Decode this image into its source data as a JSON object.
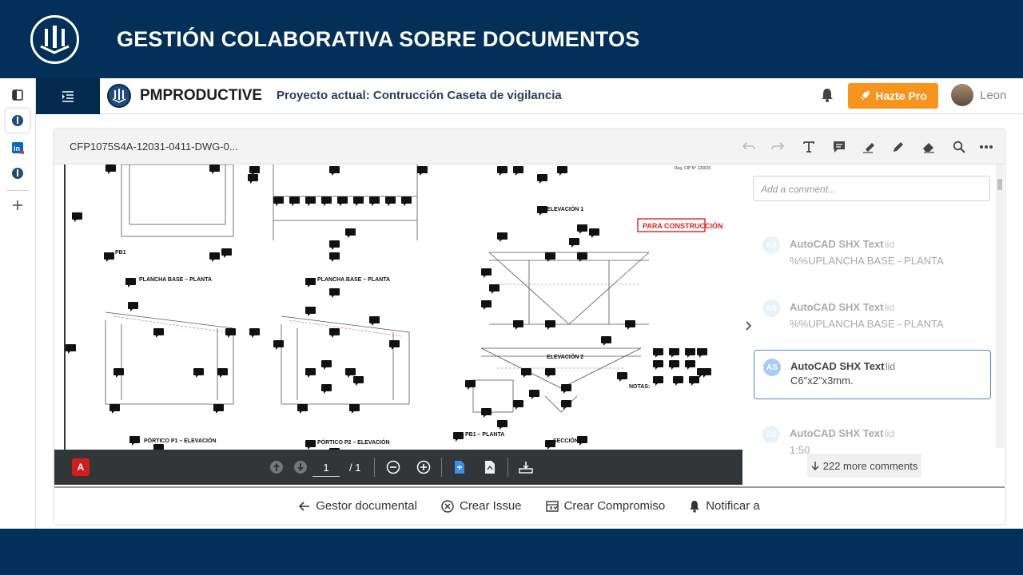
{
  "slide": {
    "title": "GESTIÓN COLABORATIVA SOBRE DOCUMENTOS",
    "colors": {
      "banner": "#023058",
      "accent": "#f7941d",
      "active_comment": "#4d8ad6"
    }
  },
  "rail": {
    "items": [
      {
        "icon": "panel-toggle-icon"
      },
      {
        "icon": "pmproductive-app-icon"
      },
      {
        "icon": "linkedin-icon"
      },
      {
        "icon": "pmproductive-app-icon"
      },
      {
        "icon": "plus-icon"
      }
    ]
  },
  "header": {
    "app_name": "PMPRODUCTIVE",
    "project": "Proyecto actual: Contrucción Caseta de vigilancia",
    "pro_button": "Hazte Pro",
    "user": "Leon"
  },
  "viewer": {
    "document_name": "CFP1075S4A-12031-0411-DWG-0...",
    "toolbar_icons": [
      "undo-icon",
      "redo-icon",
      "text-icon",
      "comment-icon",
      "highlight-icon",
      "pen-icon",
      "eraser-icon",
      "search-icon",
      "more-icon"
    ],
    "pdf": {
      "page": "1",
      "total": "/ 1",
      "logo": "A"
    }
  },
  "drawing": {
    "cip": "Reg. CIP N° 120620",
    "stamp": "PARA CONSTRUCCIÓN",
    "labels": {
      "l1": "PB1",
      "l2": "PLANCHA BASE – PLANTA",
      "l3": "PLANCHA BASE – PLANTA",
      "l4": "ELEVACIÓN 1",
      "l5": "ELEVACIÓN 2",
      "l6": "PÓRTICO P1 – ELEVACIÓN",
      "l7": "PÓRTICO P2 – ELEVACIÓN",
      "l8": "PB1 – PLANTA",
      "l9": "SECCIÓN",
      "l10": "NOTAS:"
    }
  },
  "comments": {
    "placeholder": "Add a comment...",
    "items": [
      {
        "avatar": "AS",
        "author": "AutoCAD SHX Text",
        "date": "lid",
        "text": "%%UPLANCHA BASE - PLANTA"
      },
      {
        "avatar": "AS",
        "author": "AutoCAD SHX Text",
        "date": "lid",
        "text": "%%UPLANCHA BASE - PLANTA"
      },
      {
        "avatar": "AS",
        "author": "AutoCAD SHX Text",
        "date": "lid",
        "text": "C6\"x2\"x3mm."
      },
      {
        "avatar": "AS",
        "author": "AutoCAD SHX Text",
        "date": "lid",
        "text": "1:50"
      }
    ],
    "more": "222 more comments"
  },
  "actions": {
    "gestor": "Gestor documental",
    "issue": "Crear Issue",
    "compromiso": "Crear Compromiso",
    "notificar": "Notificar a"
  }
}
